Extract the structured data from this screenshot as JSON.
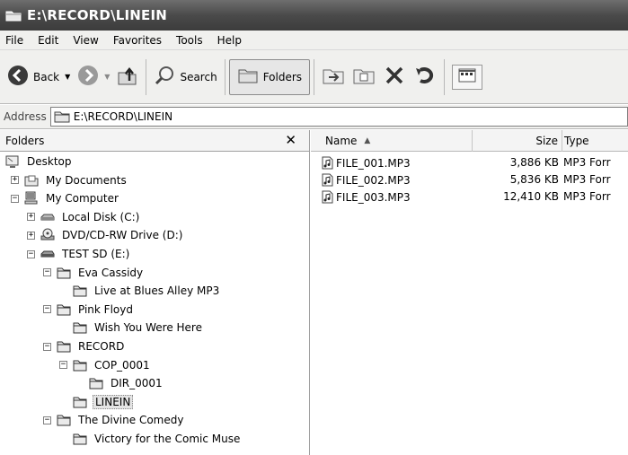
{
  "window": {
    "title": "E:\\RECORD\\LINEIN"
  },
  "menu": [
    "File",
    "Edit",
    "View",
    "Favorites",
    "Tools",
    "Help"
  ],
  "toolbar": {
    "back_label": "Back",
    "search_label": "Search",
    "folders_label": "Folders"
  },
  "address": {
    "label": "Address",
    "value": "E:\\RECORD\\LINEIN"
  },
  "folders_pane": {
    "title": "Folders",
    "close_glyph": "✕"
  },
  "tree": [
    {
      "label": "Desktop",
      "depth": 0,
      "toggle": "",
      "icon": "desktop-icon"
    },
    {
      "label": "My Documents",
      "depth": 1,
      "toggle": "+",
      "icon": "my-documents-icon"
    },
    {
      "label": "My Computer",
      "depth": 1,
      "toggle": "−",
      "icon": "computer-icon"
    },
    {
      "label": "Local Disk (C:)",
      "depth": 2,
      "toggle": "+",
      "icon": "hard-disk-icon"
    },
    {
      "label": "DVD/CD-RW Drive (D:)",
      "depth": 2,
      "toggle": "+",
      "icon": "cd-drive-icon"
    },
    {
      "label": "TEST SD (E:)",
      "depth": 2,
      "toggle": "−",
      "icon": "removable-disk-icon"
    },
    {
      "label": "Eva Cassidy",
      "depth": 3,
      "toggle": "−",
      "icon": "folder-icon"
    },
    {
      "label": "Live at Blues Alley MP3",
      "depth": 4,
      "toggle": "",
      "icon": "folder-icon"
    },
    {
      "label": "Pink Floyd",
      "depth": 3,
      "toggle": "−",
      "icon": "folder-icon"
    },
    {
      "label": "Wish You Were Here",
      "depth": 4,
      "toggle": "",
      "icon": "folder-icon"
    },
    {
      "label": "RECORD",
      "depth": 3,
      "toggle": "−",
      "icon": "folder-icon"
    },
    {
      "label": "COP_0001",
      "depth": 4,
      "toggle": "−",
      "icon": "folder-icon"
    },
    {
      "label": "DIR_0001",
      "depth": 5,
      "toggle": "",
      "icon": "folder-icon"
    },
    {
      "label": "LINEIN",
      "depth": 4,
      "toggle": "",
      "icon": "folder-icon",
      "selected": true
    },
    {
      "label": "The Divine Comedy",
      "depth": 3,
      "toggle": "−",
      "icon": "folder-icon"
    },
    {
      "label": "Victory for the Comic Muse",
      "depth": 4,
      "toggle": "",
      "icon": "folder-icon"
    }
  ],
  "list": {
    "columns": [
      "Name",
      "Size",
      "Type"
    ],
    "sort_glyph": "▲",
    "rows": [
      {
        "name": "FILE_001.MP3",
        "size": "3,886 KB",
        "type": "MP3 Forr"
      },
      {
        "name": "FILE_002.MP3",
        "size": "5,836 KB",
        "type": "MP3 Forr"
      },
      {
        "name": "FILE_003.MP3",
        "size": "12,410 KB",
        "type": "MP3 Forr"
      }
    ]
  }
}
